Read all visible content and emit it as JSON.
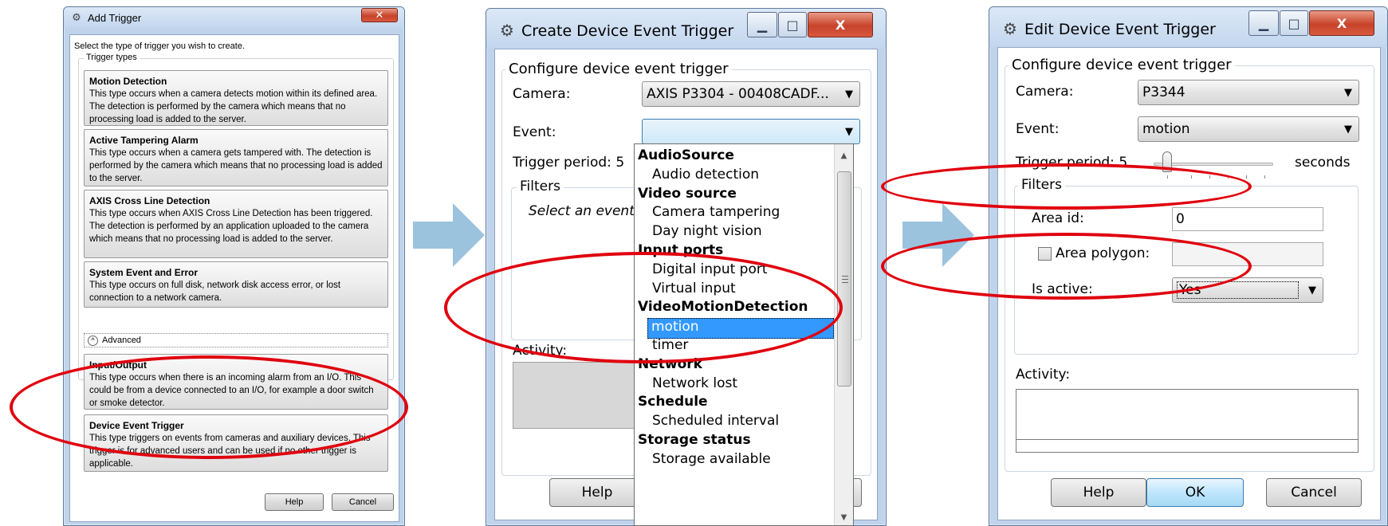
{
  "add_trigger": {
    "title": "Add Trigger",
    "close_glyph": "✕",
    "instruction": "Select the type of trigger you wish to create.",
    "group_label": "Trigger types",
    "types": [
      {
        "title": "Motion Detection",
        "desc": "This type occurs when a camera detects motion within its defined area. The detection is performed by the camera which means that no processing load is added to the server."
      },
      {
        "title": "Active Tampering Alarm",
        "desc": "This type occurs when a camera gets tampered with. The detection is performed by the camera which means that no processing load is added to the server."
      },
      {
        "title": "AXIS Cross Line Detection",
        "desc": "This type occurs when AXIS Cross Line Detection has been triggered. The detection is performed by an application uploaded to the camera which means that no processing load is added to the server."
      },
      {
        "title": "System Event and Error",
        "desc": "This type occurs on full disk, network disk access error, or lost connection to a network camera."
      },
      {
        "title": "Input/Output",
        "desc": "This type occurs when there is an incoming alarm from an I/O. This could be from a device connected to an I/O, for example a door switch or smoke detector."
      },
      {
        "title": "Device Event Trigger",
        "desc": "This type triggers on events from cameras and auxiliary devices. This trigger is for advanced users and can be used if no other trigger is applicable."
      }
    ],
    "advanced_label": "Advanced",
    "advanced_glyph": "^",
    "help_label": "Help",
    "cancel_label": "Cancel"
  },
  "create_trigger": {
    "title": "Create Device Event Trigger",
    "configure_label": "Configure device event trigger",
    "camera_label": "Camera:",
    "camera_value": "AXIS P3304 - 00408CADF...",
    "event_label": "Event:",
    "event_value": "",
    "trigger_period_label": "Trigger period:",
    "trigger_period_value": "5",
    "filters_label": "Filters",
    "filters_hint": "Select an event",
    "activity_label": "Activity:",
    "help_label": "Help",
    "dropdown": [
      {
        "label": "AudioSource",
        "kind": "group"
      },
      {
        "label": "Audio detection",
        "kind": "item"
      },
      {
        "label": "Video source",
        "kind": "group"
      },
      {
        "label": "Camera tampering",
        "kind": "item"
      },
      {
        "label": "Day night vision",
        "kind": "item"
      },
      {
        "label": "Input ports",
        "kind": "group"
      },
      {
        "label": "Digital input port",
        "kind": "item"
      },
      {
        "label": "Virtual input",
        "kind": "item"
      },
      {
        "label": "VideoMotionDetection",
        "kind": "group"
      },
      {
        "label": "motion",
        "kind": "selected"
      },
      {
        "label": "timer",
        "kind": "item"
      },
      {
        "label": "Network",
        "kind": "group"
      },
      {
        "label": "Network lost",
        "kind": "item"
      },
      {
        "label": "Schedule",
        "kind": "group"
      },
      {
        "label": "Scheduled interval",
        "kind": "item"
      },
      {
        "label": "Storage status",
        "kind": "group"
      },
      {
        "label": "Storage available",
        "kind": "item"
      }
    ]
  },
  "edit_trigger": {
    "title": "Edit Device Event Trigger",
    "configure_label": "Configure device event trigger",
    "camera_label": "Camera:",
    "camera_value": "P3344",
    "event_label": "Event:",
    "event_value": "motion",
    "trigger_period_label": "Trigger period:",
    "trigger_period_value": "5",
    "seconds_label": "seconds",
    "filters_label": "Filters",
    "area_id_label": "Area id:",
    "area_id_value": "0",
    "area_polygon_label": "Area polygon:",
    "is_active_label": "Is active:",
    "is_active_value": "Yes",
    "activity_label": "Activity:",
    "help_label": "Help",
    "ok_label": "OK",
    "cancel_label": "Cancel"
  },
  "window_glyphs": {
    "minimize": "▁",
    "maximize": "□",
    "close": "X",
    "combo_arrow": "▼"
  },
  "colors": {
    "highlight_ellipse": "#e0000e",
    "arrow": "#9cc3de",
    "selection": "#3399ff"
  }
}
